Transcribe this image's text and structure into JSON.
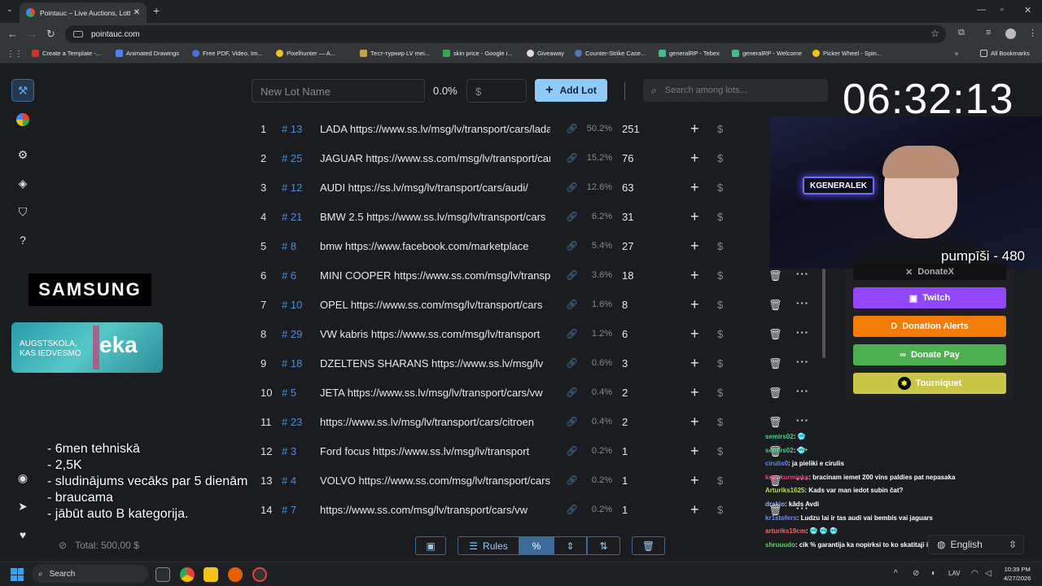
{
  "browser": {
    "tab_title": "Pointauc – Live Auctions, Lotte",
    "url": "pointauc.com",
    "bookmarks": [
      "Create a Template -...",
      "Animated Drawings",
      "Free PDF, Video, Im...",
      "Pixelhunter — A...",
      "Тест-турнир LV mei...",
      "skin price - Google i...",
      "Giveaway",
      "Counter-Strike Case...",
      "generalRP - Tebex",
      "generalRP - Welcome",
      "Picker Wheel - Spin..."
    ],
    "all_bookmarks": "All Bookmarks"
  },
  "controls": {
    "lot_name_placeholder": "New Lot Name",
    "percent": "0.0%",
    "dollar": "$",
    "add_lot": "Add Lot",
    "search_placeholder": "Search among lots..."
  },
  "lots": [
    {
      "n": "1",
      "id": "# 13",
      "name": "LADA https://www.ss.lv/msg/lv/transport/cars/lada",
      "pct": "50.2%",
      "amount": "251"
    },
    {
      "n": "2",
      "id": "# 25",
      "name": "JAGUAR https://www.ss.com/msg/lv/transport/cars",
      "pct": "15.2%",
      "amount": "76"
    },
    {
      "n": "3",
      "id": "# 12",
      "name": "AUDI https://ss.lv/msg/lv/transport/cars/audi/",
      "pct": "12.6%",
      "amount": "63"
    },
    {
      "n": "4",
      "id": "# 21",
      "name": "BMW 2.5 https://www.ss.lv/msg/lv/transport/cars",
      "pct": "6.2%",
      "amount": "31"
    },
    {
      "n": "5",
      "id": "# 8",
      "name": "bmw  https://www.facebook.com/marketplace",
      "pct": "5.4%",
      "amount": "27"
    },
    {
      "n": "6",
      "id": "# 6",
      "name": "MINI COOPER https://www.ss.com/msg/lv/transport",
      "pct": "3.6%",
      "amount": "18"
    },
    {
      "n": "7",
      "id": "# 10",
      "name": "OPEL https://www.ss.com/msg/lv/transport/cars",
      "pct": "1.6%",
      "amount": "8"
    },
    {
      "n": "8",
      "id": "# 29",
      "name": "VW kabris https://www.ss.com/msg/lv/transport",
      "pct": "1.2%",
      "amount": "6"
    },
    {
      "n": "9",
      "id": "# 18",
      "name": "DZELTENS SHARANS https://www.ss.lv/msg/lv",
      "pct": "0.6%",
      "amount": "3"
    },
    {
      "n": "10",
      "id": "# 5",
      "name": "JETA https://www.ss.lv/msg/lv/transport/cars/vw",
      "pct": "0.4%",
      "amount": "2"
    },
    {
      "n": "11",
      "id": "# 23",
      "name": "https://www.ss.lv/msg/lv/transport/cars/citroen",
      "pct": "0.4%",
      "amount": "2"
    },
    {
      "n": "12",
      "id": "# 3",
      "name": "Ford focus https://www.ss.lv/msg/lv/transport",
      "pct": "0.2%",
      "amount": "1"
    },
    {
      "n": "13",
      "id": "# 4",
      "name": "VOLVO https://www.ss.com/msg/lv/transport/cars",
      "pct": "0.2%",
      "amount": "1"
    },
    {
      "n": "14",
      "id": "# 7",
      "name": "https://www.ss.com/msg/lv/transport/cars/vw",
      "pct": "0.2%",
      "amount": "1"
    }
  ],
  "sponsors": {
    "samsung": "SAMSUNG",
    "eka_small": "AUGSTSKOLA, KAS IEDVESMO",
    "eka_big": "eka"
  },
  "notes": [
    "- 6men tehniskā",
    "- 2,5K",
    "- sludinājums vecāks par 5 dienām",
    "- braucama",
    "- jābūt auto B kategorija."
  ],
  "total": "Total: 500,00 $",
  "toolbar": {
    "rules": "Rules"
  },
  "timer": "06:32:13",
  "webcam": {
    "neon_text": "KGENERALEK",
    "caption": "pumpīši - 480"
  },
  "donate": {
    "donatex": "DonateX",
    "twitch": "Twitch",
    "alerts": "Donation Alerts",
    "pay": "Donate Pay",
    "tourniquet": "Tourniquet"
  },
  "chat": [
    {
      "user": "semirs02",
      "msg": ": 🥶"
    },
    {
      "user": "semirs02",
      "msg": ": 🥶"
    },
    {
      "user": "cirulis0",
      "msg": ": ja pieliki e cirulis"
    },
    {
      "user": "kus_kurmieks",
      "msg": ": bracinam iemet 200 vins paldies pat nepasaka"
    },
    {
      "user": "Arturiks1625",
      "msg": ": Kads var man iedot subin čat?"
    },
    {
      "user": "drakio",
      "msg": ": kāds Avdi"
    },
    {
      "user": "kr1stofers",
      "msg": ": Ludzu lai ir tas audi vai bembis vai jaguars"
    },
    {
      "user": "arturiks19cm",
      "msg": ": 🥶 🥶 🥶"
    },
    {
      "user": "shruuudo",
      "msg": ": cik % garantija ka nopirksi to ko skatitaji izvelas"
    }
  ],
  "language": "English",
  "taskbar": {
    "search": "Search",
    "time": "10:39 PM",
    "date": "4/27/2026",
    "lang": "LAV"
  },
  "colors": {
    "accent": "#90caf9",
    "twitch": "#9146ff",
    "alerts": "#f57d07",
    "pay": "#4caf50",
    "tourniquet": "#c9c64a"
  }
}
